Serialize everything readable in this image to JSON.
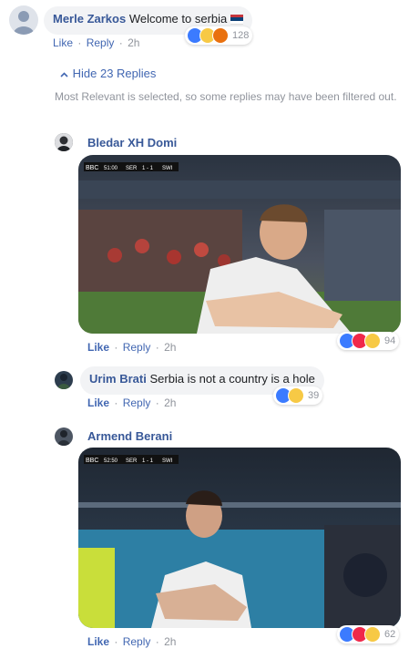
{
  "comment": {
    "author": "Merle Zarkos",
    "text": "Welcome to serbia",
    "flag_icon": "serbia-flag-icon",
    "actions": {
      "like": "Like",
      "reply": "Reply",
      "time": "2h"
    },
    "reactions": {
      "icons": [
        "like-reaction-icon",
        "haha-reaction-icon",
        "angry-reaction-icon"
      ],
      "count": "128"
    }
  },
  "replies_toggle": {
    "label": "Hide 23 Replies",
    "icon": "chevron-up-icon"
  },
  "notice": "Most Relevant is selected, so some replies may have been filtered out.",
  "replies": [
    {
      "author": "Bledar XH Domi",
      "media": {
        "scoreboard": {
          "channel": "BBC",
          "time": "51:00",
          "home": "SER",
          "score": "1 - 1",
          "away": "SWI"
        }
      },
      "actions": {
        "like": "Like",
        "reply": "Reply",
        "time": "2h"
      },
      "reactions": {
        "icons": [
          "like-reaction-icon",
          "love-reaction-icon",
          "haha-reaction-icon"
        ],
        "count": "94"
      }
    },
    {
      "author": "Urim Brati",
      "text": "Serbia is not a country is a hole",
      "actions": {
        "like": "Like",
        "reply": "Reply",
        "time": "2h"
      },
      "reactions": {
        "icons": [
          "like-reaction-icon",
          "haha-reaction-icon"
        ],
        "count": "39"
      }
    },
    {
      "author": "Armend Berani",
      "media": {
        "scoreboard": {
          "channel": "BBC",
          "time": "52:50",
          "home": "SER",
          "score": "1 - 1",
          "away": "SWI"
        }
      },
      "actions": {
        "like": "Like",
        "reply": "Reply",
        "time": "2h"
      },
      "reactions": {
        "icons": [
          "like-reaction-icon",
          "love-reaction-icon",
          "haha-reaction-icon"
        ],
        "count": "62"
      }
    }
  ],
  "colors": {
    "link": "#385898",
    "action": "#4267b2",
    "muted": "#90949c",
    "bubble": "#f2f3f5"
  }
}
